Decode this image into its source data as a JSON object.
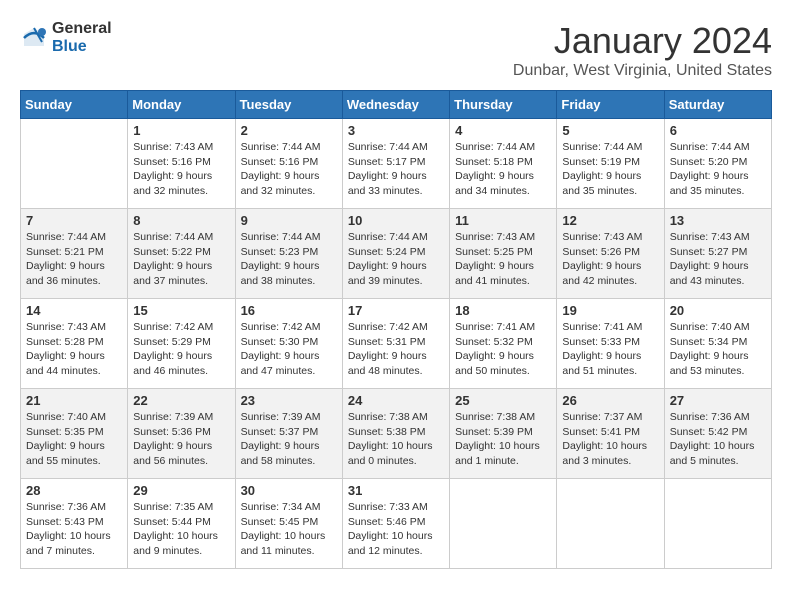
{
  "logo": {
    "general": "General",
    "blue": "Blue"
  },
  "title": "January 2024",
  "location": "Dunbar, West Virginia, United States",
  "headers": [
    "Sunday",
    "Monday",
    "Tuesday",
    "Wednesday",
    "Thursday",
    "Friday",
    "Saturday"
  ],
  "weeks": [
    [
      {
        "day": "",
        "info": ""
      },
      {
        "day": "1",
        "info": "Sunrise: 7:43 AM\nSunset: 5:16 PM\nDaylight: 9 hours\nand 32 minutes."
      },
      {
        "day": "2",
        "info": "Sunrise: 7:44 AM\nSunset: 5:16 PM\nDaylight: 9 hours\nand 32 minutes."
      },
      {
        "day": "3",
        "info": "Sunrise: 7:44 AM\nSunset: 5:17 PM\nDaylight: 9 hours\nand 33 minutes."
      },
      {
        "day": "4",
        "info": "Sunrise: 7:44 AM\nSunset: 5:18 PM\nDaylight: 9 hours\nand 34 minutes."
      },
      {
        "day": "5",
        "info": "Sunrise: 7:44 AM\nSunset: 5:19 PM\nDaylight: 9 hours\nand 35 minutes."
      },
      {
        "day": "6",
        "info": "Sunrise: 7:44 AM\nSunset: 5:20 PM\nDaylight: 9 hours\nand 35 minutes."
      }
    ],
    [
      {
        "day": "7",
        "info": "Sunrise: 7:44 AM\nSunset: 5:21 PM\nDaylight: 9 hours\nand 36 minutes."
      },
      {
        "day": "8",
        "info": "Sunrise: 7:44 AM\nSunset: 5:22 PM\nDaylight: 9 hours\nand 37 minutes."
      },
      {
        "day": "9",
        "info": "Sunrise: 7:44 AM\nSunset: 5:23 PM\nDaylight: 9 hours\nand 38 minutes."
      },
      {
        "day": "10",
        "info": "Sunrise: 7:44 AM\nSunset: 5:24 PM\nDaylight: 9 hours\nand 39 minutes."
      },
      {
        "day": "11",
        "info": "Sunrise: 7:43 AM\nSunset: 5:25 PM\nDaylight: 9 hours\nand 41 minutes."
      },
      {
        "day": "12",
        "info": "Sunrise: 7:43 AM\nSunset: 5:26 PM\nDaylight: 9 hours\nand 42 minutes."
      },
      {
        "day": "13",
        "info": "Sunrise: 7:43 AM\nSunset: 5:27 PM\nDaylight: 9 hours\nand 43 minutes."
      }
    ],
    [
      {
        "day": "14",
        "info": "Sunrise: 7:43 AM\nSunset: 5:28 PM\nDaylight: 9 hours\nand 44 minutes."
      },
      {
        "day": "15",
        "info": "Sunrise: 7:42 AM\nSunset: 5:29 PM\nDaylight: 9 hours\nand 46 minutes."
      },
      {
        "day": "16",
        "info": "Sunrise: 7:42 AM\nSunset: 5:30 PM\nDaylight: 9 hours\nand 47 minutes."
      },
      {
        "day": "17",
        "info": "Sunrise: 7:42 AM\nSunset: 5:31 PM\nDaylight: 9 hours\nand 48 minutes."
      },
      {
        "day": "18",
        "info": "Sunrise: 7:41 AM\nSunset: 5:32 PM\nDaylight: 9 hours\nand 50 minutes."
      },
      {
        "day": "19",
        "info": "Sunrise: 7:41 AM\nSunset: 5:33 PM\nDaylight: 9 hours\nand 51 minutes."
      },
      {
        "day": "20",
        "info": "Sunrise: 7:40 AM\nSunset: 5:34 PM\nDaylight: 9 hours\nand 53 minutes."
      }
    ],
    [
      {
        "day": "21",
        "info": "Sunrise: 7:40 AM\nSunset: 5:35 PM\nDaylight: 9 hours\nand 55 minutes."
      },
      {
        "day": "22",
        "info": "Sunrise: 7:39 AM\nSunset: 5:36 PM\nDaylight: 9 hours\nand 56 minutes."
      },
      {
        "day": "23",
        "info": "Sunrise: 7:39 AM\nSunset: 5:37 PM\nDaylight: 9 hours\nand 58 minutes."
      },
      {
        "day": "24",
        "info": "Sunrise: 7:38 AM\nSunset: 5:38 PM\nDaylight: 10 hours\nand 0 minutes."
      },
      {
        "day": "25",
        "info": "Sunrise: 7:38 AM\nSunset: 5:39 PM\nDaylight: 10 hours\nand 1 minute."
      },
      {
        "day": "26",
        "info": "Sunrise: 7:37 AM\nSunset: 5:41 PM\nDaylight: 10 hours\nand 3 minutes."
      },
      {
        "day": "27",
        "info": "Sunrise: 7:36 AM\nSunset: 5:42 PM\nDaylight: 10 hours\nand 5 minutes."
      }
    ],
    [
      {
        "day": "28",
        "info": "Sunrise: 7:36 AM\nSunset: 5:43 PM\nDaylight: 10 hours\nand 7 minutes."
      },
      {
        "day": "29",
        "info": "Sunrise: 7:35 AM\nSunset: 5:44 PM\nDaylight: 10 hours\nand 9 minutes."
      },
      {
        "day": "30",
        "info": "Sunrise: 7:34 AM\nSunset: 5:45 PM\nDaylight: 10 hours\nand 11 minutes."
      },
      {
        "day": "31",
        "info": "Sunrise: 7:33 AM\nSunset: 5:46 PM\nDaylight: 10 hours\nand 12 minutes."
      },
      {
        "day": "",
        "info": ""
      },
      {
        "day": "",
        "info": ""
      },
      {
        "day": "",
        "info": ""
      }
    ]
  ]
}
